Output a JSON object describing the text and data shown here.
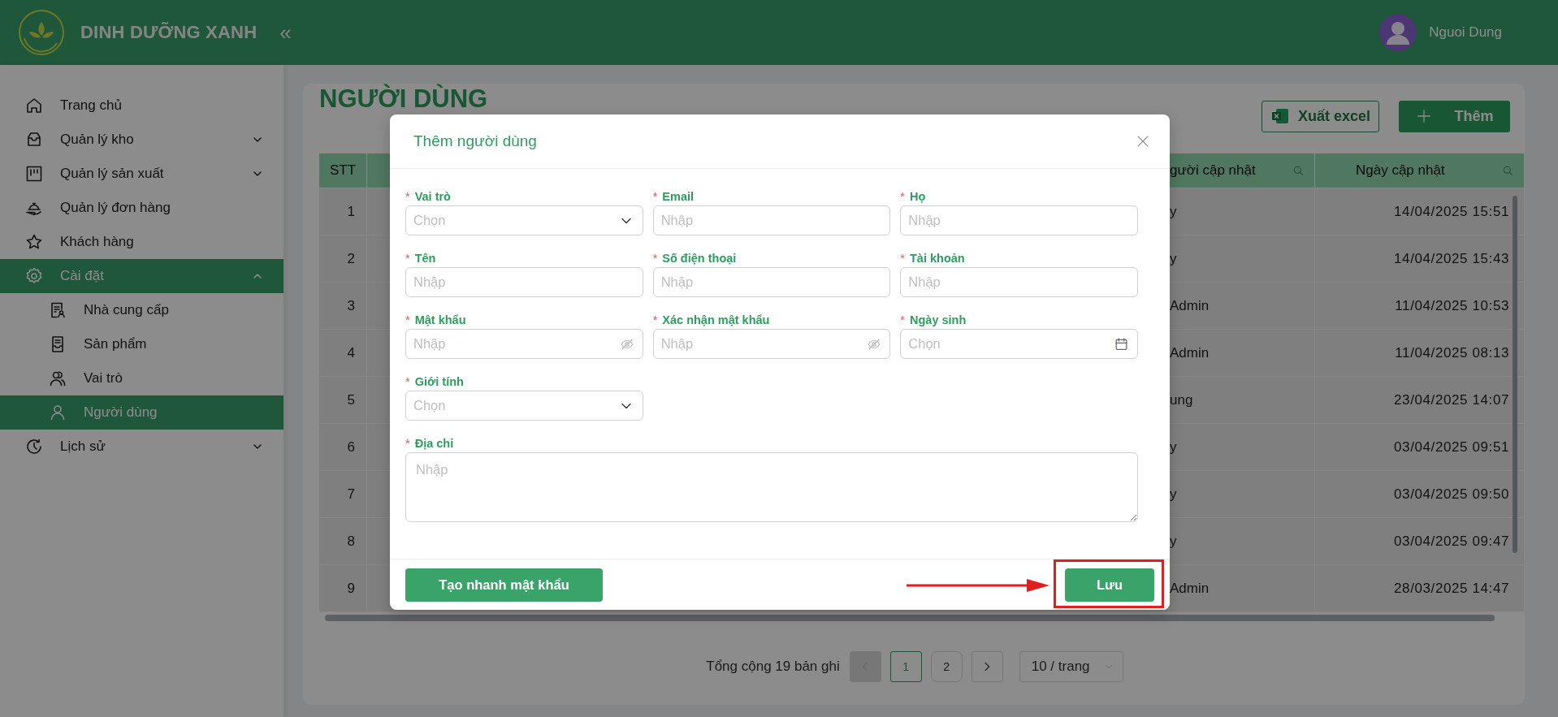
{
  "header": {
    "brand": "DINH DƯỠNG XANH",
    "collapse": "«",
    "user_name": "Nguoi Dung"
  },
  "sidebar": {
    "items": [
      {
        "label": "Trang chủ",
        "selected": false
      },
      {
        "label": "Quản lý kho",
        "selected": false,
        "expanded": false
      },
      {
        "label": "Quản lý sản xuất",
        "selected": false,
        "expanded": false
      },
      {
        "label": "Quản lý đơn hàng",
        "selected": false
      },
      {
        "label": "Khách hàng",
        "selected": false
      },
      {
        "label": "Cài đặt",
        "selected": true,
        "expanded": true,
        "children": [
          {
            "label": "Nhà cung cấp",
            "selected": false
          },
          {
            "label": "Sản phẩm",
            "selected": false
          },
          {
            "label": "Vai trò",
            "selected": false
          },
          {
            "label": "Người dùng",
            "selected": true
          }
        ]
      },
      {
        "label": "Lịch sử",
        "selected": false,
        "expanded": false
      }
    ]
  },
  "page": {
    "title": "NGƯỜI DÙNG",
    "export_button": "Xuất excel",
    "add_button": "Thêm"
  },
  "table": {
    "columns": [
      {
        "label": "STT",
        "filter": false
      },
      {
        "label": "gười cập nhật",
        "filter": true
      },
      {
        "label": "Ngày cập nhật",
        "filter": true
      }
    ],
    "rows": [
      {
        "stt": "1",
        "updated_by": "y",
        "updated_at": "14/04/2025 15:51"
      },
      {
        "stt": "2",
        "updated_by": "y",
        "updated_at": "14/04/2025 15:43"
      },
      {
        "stt": "3",
        "updated_by": "Admin",
        "updated_at": "11/04/2025 10:53"
      },
      {
        "stt": "4",
        "updated_by": "Admin",
        "updated_at": "11/04/2025 08:13"
      },
      {
        "stt": "5",
        "updated_by": "ung",
        "updated_at": "23/04/2025 14:07"
      },
      {
        "stt": "6",
        "updated_by": "y",
        "updated_at": "03/04/2025 09:51"
      },
      {
        "stt": "7",
        "updated_by": "y",
        "updated_at": "03/04/2025 09:50"
      },
      {
        "stt": "8",
        "updated_by": "y",
        "updated_at": "03/04/2025 09:47"
      },
      {
        "stt": "9",
        "updated_by": "Admin",
        "updated_at": "28/03/2025 14:47"
      }
    ]
  },
  "pagination": {
    "total": "Tổng cộng 19 bản ghi",
    "prev_disabled": true,
    "pages": [
      {
        "label": "1",
        "selected": true
      },
      {
        "label": "2",
        "selected": false
      }
    ],
    "page_size": "10 / trang"
  },
  "modal": {
    "title": "Thêm người dùng",
    "fields": [
      {
        "label": "Vai trò",
        "mark": "*",
        "kind": "select",
        "placeholder": "Chọn"
      },
      {
        "label": "Email",
        "mark": "*",
        "kind": "text",
        "placeholder": "Nhập"
      },
      {
        "label": "Họ",
        "mark": "*",
        "kind": "text",
        "placeholder": "Nhập"
      },
      {
        "label": "Tên",
        "mark": "*",
        "kind": "text",
        "placeholder": "Nhập"
      },
      {
        "label": "Số điện thoại",
        "mark": "*",
        "kind": "text",
        "placeholder": "Nhập"
      },
      {
        "label": "Tài khoản",
        "mark": "*",
        "kind": "text",
        "placeholder": "Nhập"
      },
      {
        "label": "Mật khẩu",
        "mark": "*",
        "kind": "password",
        "placeholder": "Nhập"
      },
      {
        "label": "Xác nhận mật khẩu",
        "mark": "*",
        "kind": "password",
        "placeholder": "Nhập"
      },
      {
        "label": "Ngày sinh",
        "mark": "*",
        "kind": "date",
        "placeholder": "Chọn"
      },
      {
        "label": "Giới tính",
        "mark": "*",
        "kind": "select",
        "placeholder": "Chọn"
      },
      {
        "label": "Địa chỉ",
        "mark": "*",
        "kind": "textarea",
        "placeholder": "Nhập"
      }
    ],
    "buttons": [
      {
        "label": "Tạo nhanh mật khẩu"
      },
      {
        "label": "Lưu",
        "highlighted": true
      }
    ]
  }
}
